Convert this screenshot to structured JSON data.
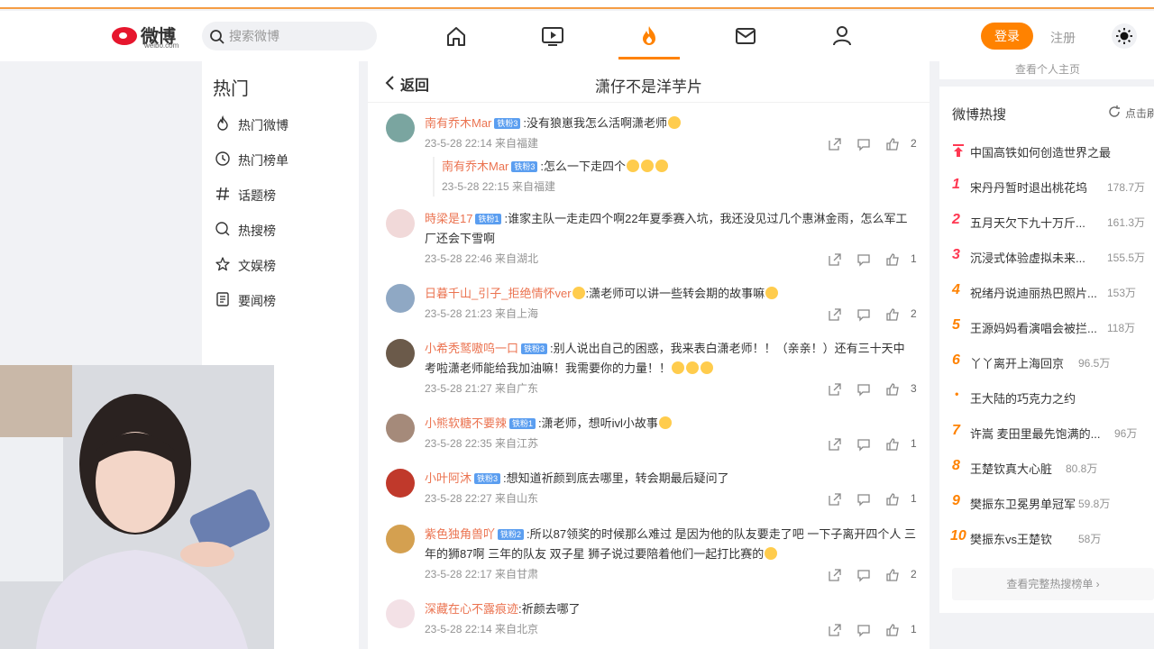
{
  "header": {
    "logo_text": "微博",
    "logo_sub": "weibo.com",
    "search_placeholder": "搜索微博",
    "login_label": "登录",
    "register_label": "注册"
  },
  "nav": {
    "icons": [
      "home-icon",
      "video-icon",
      "hot-icon",
      "message-icon",
      "profile-icon"
    ],
    "active": "hot-icon",
    "accent_color": "#ff8200"
  },
  "sidebar": {
    "title": "热门",
    "items": [
      {
        "label": "热门微博",
        "icon": "flame-icon"
      },
      {
        "label": "热门榜单",
        "icon": "clock-icon"
      },
      {
        "label": "话题榜",
        "icon": "hash-icon"
      },
      {
        "label": "热搜榜",
        "icon": "search-circle-icon"
      },
      {
        "label": "文娱榜",
        "icon": "star-icon"
      },
      {
        "label": "要闻榜",
        "icon": "news-icon"
      }
    ]
  },
  "main": {
    "back_label": "返回",
    "title": "潇仔不是洋芋片",
    "comments": [
      {
        "user": "南有乔木Mar",
        "badge": "铁粉3",
        "text": ":没有狼崽我怎么活啊潇老师",
        "meta": "23-5-28 22:14 来自福建",
        "likes": "2",
        "reply": {
          "user": "南有乔木Mar",
          "badge": "铁粉3",
          "text": ":怎么一下走四个",
          "meta": "23-5-28 22:15 来自福建"
        }
      },
      {
        "user": "時梁是17",
        "badge": "铁粉1",
        "text": ":谁家主队一走走四个啊22年夏季赛入坑，我还没见过几个惠淋金雨，怎么军工厂还会下雪啊",
        "meta": "23-5-28 22:46 来自湖北",
        "likes": "1"
      },
      {
        "user": "日暮千山_引子_拒绝情怀ver",
        "badge": "",
        "text": ":潇老师可以讲一些转会期的故事嘛",
        "meta": "23-5-28 21:23 来自上海",
        "likes": "2"
      },
      {
        "user": "小希秃鹫嗷呜一口",
        "badge": "铁粉3",
        "text": ":别人说出自己的困惑，我来表白潇老师！！（亲亲！）还有三十天中考啦潇老师能给我加油嘛！我需要你的力量！！",
        "meta": "23-5-28 21:27 来自广东",
        "likes": "3"
      },
      {
        "user": "小熊软糖不要辣",
        "badge": "铁粉1",
        "text": ":潇老师，想听ivl小故事",
        "meta": "23-5-28 22:35 来自江苏",
        "likes": "1"
      },
      {
        "user": "小叶阿沐",
        "badge": "铁粉3",
        "text": ":想知道祈颜到底去哪里，转会期最后疑问了",
        "meta": "23-5-28 22:27 来自山东",
        "likes": "1"
      },
      {
        "user": "紫色独角兽吖",
        "badge": "铁粉2",
        "text": ":所以87领奖的时候那么难过 是因为他的队友要走了吧 一下子离开四个人 三年的狮87啊 三年的队友 双子星 狮子说过要陪着他们一起打比赛的",
        "meta": "23-5-28 22:17 来自甘肃",
        "likes": "2"
      },
      {
        "user": "深藏在心不露痕迹",
        "badge": "",
        "text": ":祈颜去哪了",
        "meta": "23-5-28 22:14 来自北京",
        "likes": "1"
      }
    ]
  },
  "right": {
    "top_link": "查看个人主页",
    "hot_title": "微博热搜",
    "refresh_label": "点击刷新",
    "pinned": "中国高铁如何创造世界之最",
    "items": [
      {
        "rank": "1",
        "text": "宋丹丹暂时退出桃花坞",
        "count": "178.7万"
      },
      {
        "rank": "2",
        "text": "五月天欠下九十万斤...",
        "count": "161.3万"
      },
      {
        "rank": "3",
        "text": "沉浸式体验虚拟未来...",
        "count": "155.5万"
      },
      {
        "rank": "4",
        "text": "祝绪丹说迪丽热巴照片...",
        "count": "153万"
      },
      {
        "rank": "5",
        "text": "王源妈妈看演唱会被拦...",
        "count": "118万"
      },
      {
        "rank": "6",
        "text": "丫丫离开上海回京",
        "count": "96.5万"
      },
      {
        "rank": "•",
        "text": "王大陆的巧克力之约",
        "count": ""
      },
      {
        "rank": "7",
        "text": "许嵩 麦田里最先饱满的...",
        "count": "96万"
      },
      {
        "rank": "8",
        "text": "王楚钦真大心脏",
        "count": "80.8万"
      },
      {
        "rank": "9",
        "text": "樊振东卫冕男单冠军",
        "count": "59.8万"
      },
      {
        "rank": "10",
        "text": "樊振东vs王楚钦",
        "count": "58万"
      }
    ],
    "view_all": "查看完整热搜榜单"
  }
}
